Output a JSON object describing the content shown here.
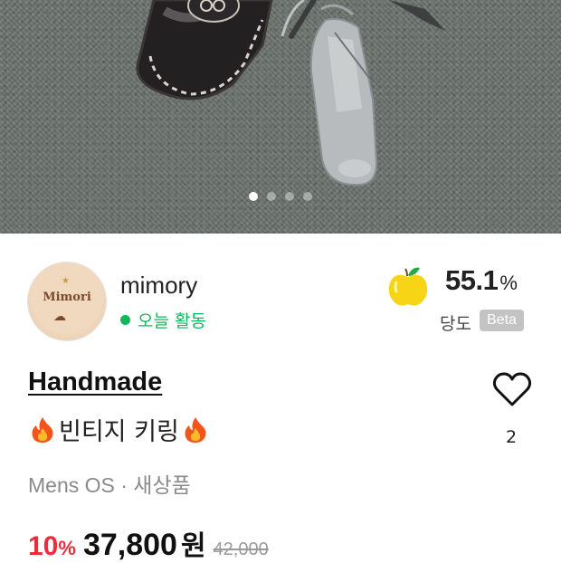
{
  "hero": {
    "image_alt": "vintage pocket knife keyring on leather sheath",
    "page_count": 4,
    "current_page": 1
  },
  "seller": {
    "avatar_text": "Mimori",
    "name": "mimory",
    "activity": "오늘 활동",
    "status_color": "#12b75a"
  },
  "sweetness": {
    "icon": "yellow-apple-icon",
    "value": "55.1",
    "unit": "%",
    "label": "당도",
    "badge": "Beta"
  },
  "product": {
    "category": "Handmade",
    "title_icon": "fire-icon",
    "title": "빈티지 키링",
    "meta": "Mens OS · 새상품",
    "likes": "2",
    "like_icon": "heart-outline-icon"
  },
  "price": {
    "discount_value": "10",
    "discount_unit": "%",
    "sale": "37,800",
    "currency": "원",
    "original": "42,000",
    "discount_color": "#ef2b3c"
  }
}
